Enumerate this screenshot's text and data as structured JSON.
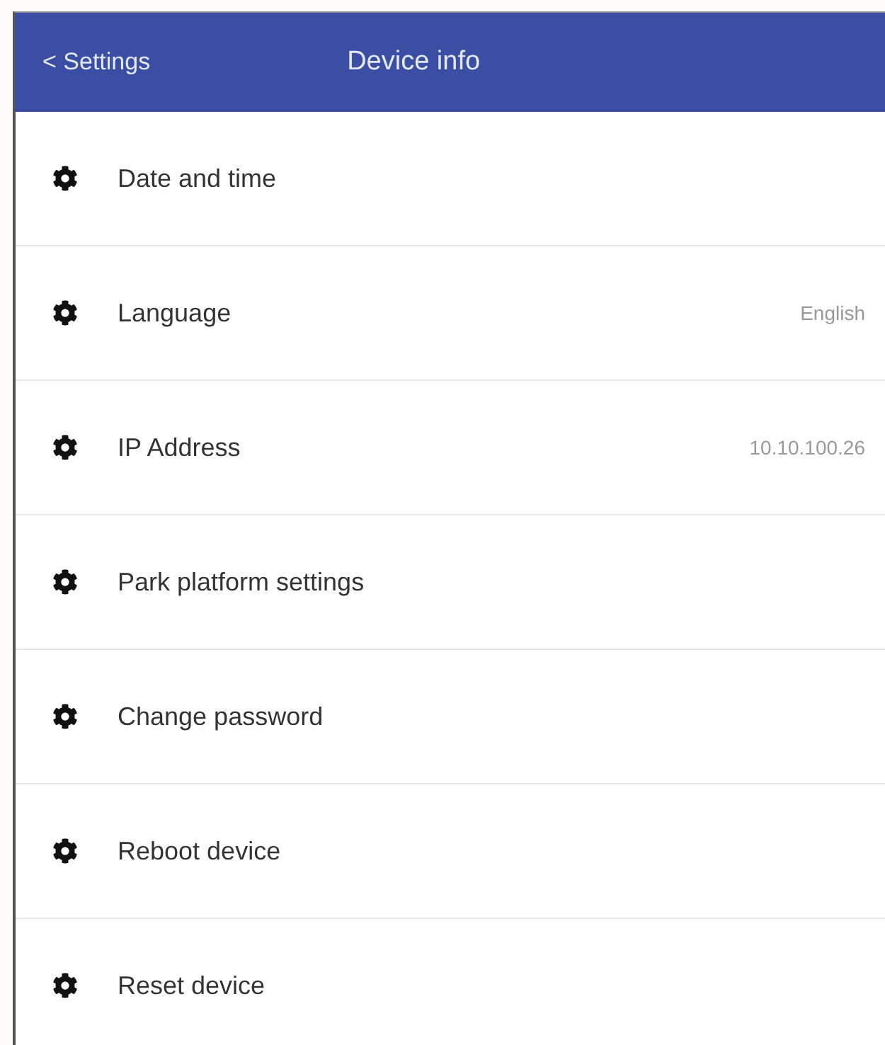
{
  "header": {
    "back": "< Settings",
    "title": "Device info"
  },
  "items": [
    {
      "label": "Date and time"
    },
    {
      "label": "Language",
      "value": "English"
    },
    {
      "label": "IP Address",
      "value": "10.10.100.26"
    },
    {
      "label": "Park platform settings"
    },
    {
      "label": "Change password"
    },
    {
      "label": "Reboot device"
    },
    {
      "label": "Reset device"
    }
  ]
}
